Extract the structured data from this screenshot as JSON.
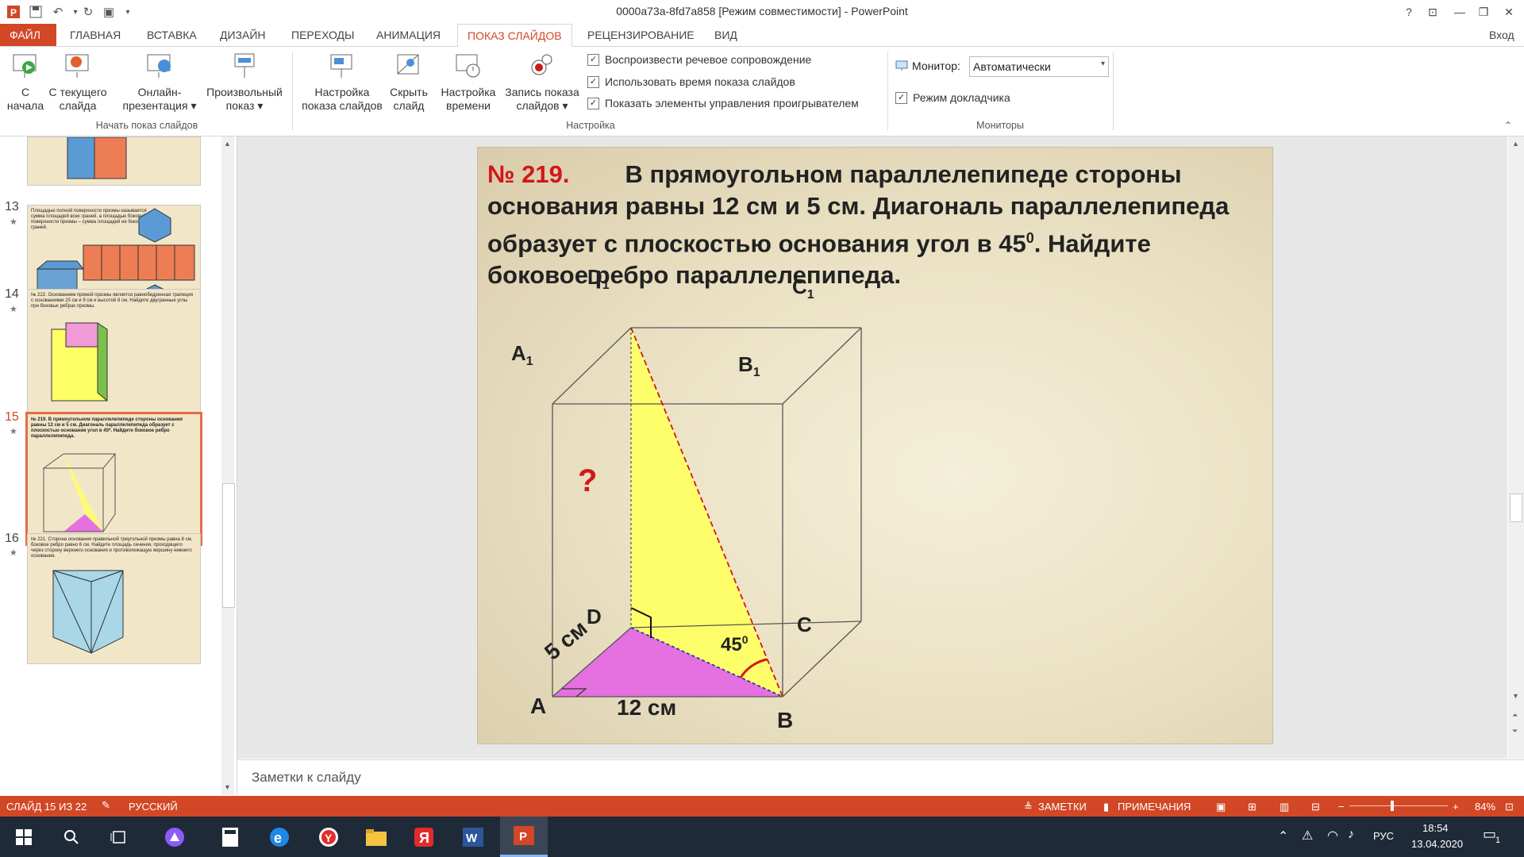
{
  "window": {
    "title": "0000a73a-8fd7a858 [Режим совместимости] - PowerPoint",
    "help": "?",
    "signin": "Вход"
  },
  "tabs": [
    "ФАЙЛ",
    "ГЛАВНАЯ",
    "ВСТАВКА",
    "ДИЗАЙН",
    "ПЕРЕХОДЫ",
    "АНИМАЦИЯ",
    "ПОКАЗ СЛАЙДОВ",
    "РЕЦЕНЗИРОВАНИЕ",
    "ВИД"
  ],
  "ribbon": {
    "start_group": {
      "label": "Начать показ слайдов",
      "buttons": [
        {
          "l1": "С",
          "l2": "начала"
        },
        {
          "l1": "С текущего",
          "l2": "слайда"
        },
        {
          "l1": "Онлайн-",
          "l2": "презентация ▾"
        },
        {
          "l1": "Произвольный",
          "l2": "показ ▾"
        }
      ]
    },
    "setup_group": {
      "label": "Настройка",
      "buttons": [
        {
          "l1": "Настройка",
          "l2": "показа слайдов"
        },
        {
          "l1": "Скрыть",
          "l2": "слайд"
        },
        {
          "l1": "Настройка",
          "l2": "времени"
        },
        {
          "l1": "Запись показа",
          "l2": "слайдов ▾"
        }
      ],
      "checks": [
        {
          "label": "Воспроизвести речевое сопровождение",
          "checked": "✓"
        },
        {
          "label": "Использовать время показа слайдов",
          "checked": "✓"
        },
        {
          "label": "Показать элементы управления проигрывателем",
          "checked": "✓"
        }
      ]
    },
    "monitors_group": {
      "label": "Мониторы",
      "monitor_label": "Монитор:",
      "monitor_value": "Автоматически",
      "presenter": {
        "label": "Режим докладчика",
        "checked": "✓"
      }
    }
  },
  "thumbnails": [
    {
      "num": "13",
      "text": "Площадью полной поверхности призмы называется сумма площадей всех граней, а площадью боковой поверхности призмы – сумма площадей ее боковых граней."
    },
    {
      "num": "14",
      "text": "№ 222. Основанием прямой призмы является равнобедренная трапеция с основаниями 25 см и 9 см и высотой 8 см. Найдите двугранные углы при боковых ребрах призмы."
    },
    {
      "num": "15",
      "text": "№ 219. В прямоугольном параллелепипеде стороны основания равны 12 см и 5 см. Диагональ параллелепипеда образует с плоскостью основания угол в 45⁰. Найдите боковое ребро параллелепипеда."
    },
    {
      "num": "16",
      "text": "№ 221. Сторона основания правильной треугольной призмы равна 8 см, боковое ребро равно 6 см. Найдите площадь сечения, проходящего через сторону верхнего основания и противолежащую вершину нижнего основания."
    }
  ],
  "slide": {
    "number_label": "№ 219.",
    "problem_text": "В прямоугольном параллелепипеде стороны основания равны 12 см и 5 см. Диагональ параллелепипеда образует с плоскостью основания угол в 45",
    "problem_sup": "0",
    "problem_end": ". Найдите боковое ребро параллелепипеда.",
    "labels": {
      "D1": "D",
      "C1": "C",
      "A1": "A",
      "B1": "B",
      "sub1": "1",
      "A": "A",
      "B": "B",
      "C": "C",
      "D": "D",
      "q": "?",
      "len_ab": "12 см",
      "len_ad": "5 см",
      "angle": "45",
      "angle_sup": "0"
    }
  },
  "notes_placeholder": "Заметки к слайду",
  "status": {
    "slide_info": "СЛАЙД 15 ИЗ 22",
    "language": "РУССКИЙ",
    "notes_btn": "ЗАМЕТКИ",
    "comments_btn": "ПРИМЕЧАНИЯ",
    "zoom": "84%"
  },
  "taskbar": {
    "lang": "РУС",
    "time": "18:54",
    "date": "13.04.2020",
    "notif_count": "1"
  },
  "colors": {
    "accent": "#d24726",
    "triangle_yellow": "#ffff66",
    "base_magenta": "#e570e0",
    "red": "#d01818"
  }
}
